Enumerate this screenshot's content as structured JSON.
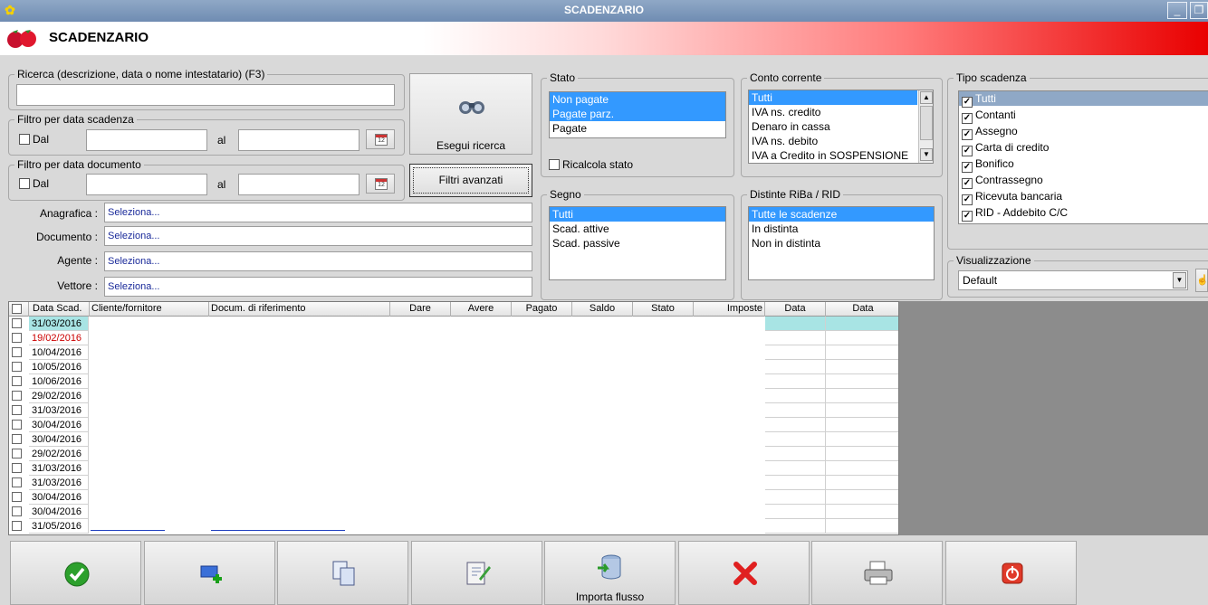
{
  "window": {
    "title": "SCADENZARIO",
    "minimize": "_",
    "restore": "❐"
  },
  "header": {
    "title": "SCADENZARIO"
  },
  "search": {
    "legend": "Ricerca (descrizione, data o nome intestatario) (F3)",
    "value": ""
  },
  "filter_scadenza": {
    "legend": "Filtro per data scadenza",
    "dal": "Dal",
    "al": "al"
  },
  "filter_documento": {
    "legend": "Filtro per data documento",
    "dal": "Dal",
    "al": "al"
  },
  "buttons": {
    "esegui": "Esegui ricerca",
    "filtri": "Filtri avanzati"
  },
  "fields": [
    {
      "label": "Anagrafica :",
      "value": "Seleziona..."
    },
    {
      "label": "Documento :",
      "value": "Seleziona..."
    },
    {
      "label": "Agente :",
      "value": "Seleziona..."
    },
    {
      "label": "Vettore :",
      "value": "Seleziona..."
    }
  ],
  "stato": {
    "legend": "Stato",
    "items": [
      "Non pagate",
      "Pagate parz.",
      "Pagate"
    ],
    "ricalcola": "Ricalcola stato"
  },
  "segno": {
    "legend": "Segno",
    "items": [
      "Tutti",
      "Scad. attive",
      "Scad. passive"
    ]
  },
  "conto": {
    "legend": "Conto corrente",
    "items": [
      "Tutti",
      "IVA ns. credito",
      "Denaro in cassa",
      "IVA ns. debito",
      "IVA a Credito in SOSPENSIONE"
    ]
  },
  "distinte": {
    "legend": "Distinte RiBa / RID",
    "items": [
      "Tutte le scadenze",
      "In distinta",
      "Non in distinta"
    ]
  },
  "tipo": {
    "legend": "Tipo scadenza",
    "items": [
      "Tutti",
      "Contanti",
      "Assegno",
      "Carta di credito",
      "Bonifico",
      "Contrassegno",
      "Ricevuta bancaria",
      "RID - Addebito C/C"
    ]
  },
  "visualizzazione": {
    "legend": "Visualizzazione",
    "value": "Default"
  },
  "grid": {
    "columns": [
      "Data Scad.",
      "Cliente/fornitore",
      "Docum. di riferimento",
      "Dare",
      "Avere",
      "Pagato",
      "Saldo",
      "Stato",
      "Imposte",
      "Data",
      "Data"
    ],
    "rows": [
      "31/03/2016",
      "19/02/2016",
      "10/04/2016",
      "10/05/2016",
      "10/06/2016",
      "29/02/2016",
      "31/03/2016",
      "30/04/2016",
      "30/04/2016",
      "29/02/2016",
      "31/03/2016",
      "31/03/2016",
      "30/04/2016",
      "30/04/2016",
      "31/05/2016"
    ]
  },
  "toolbar": {
    "importa": "Importa flusso"
  },
  "colors": {
    "selection": "#3399ff",
    "overdue": "#cc0000",
    "highlight_row": "#a8e4e4"
  }
}
